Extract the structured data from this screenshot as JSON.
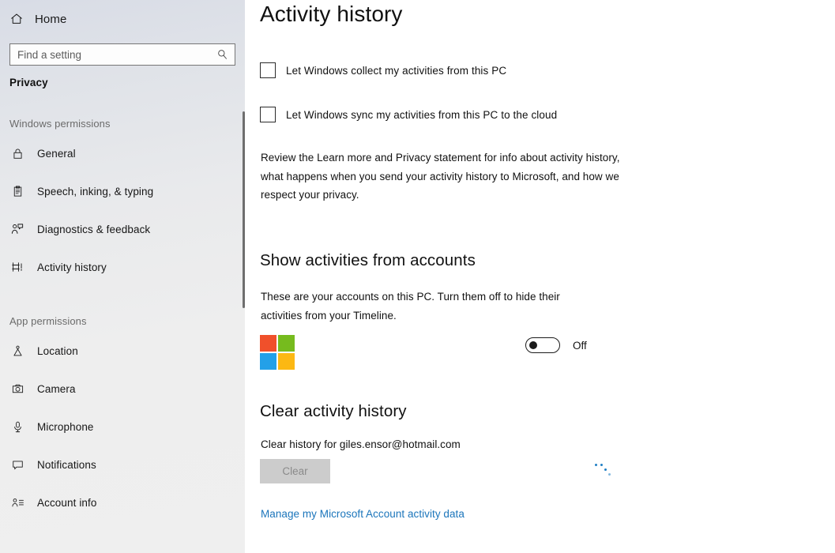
{
  "sidebar": {
    "home": {
      "label": "Home",
      "icon": "home-icon"
    },
    "search": {
      "placeholder": "Find a setting",
      "value": "",
      "icon": "search-icon"
    },
    "category": "Privacy",
    "groups": [
      {
        "heading": "Windows permissions",
        "items": [
          {
            "label": "General",
            "icon": "lock-icon"
          },
          {
            "label": "Speech, inking, & typing",
            "icon": "clipboard-icon"
          },
          {
            "label": "Diagnostics & feedback",
            "icon": "person-feedback-icon"
          },
          {
            "label": "Activity history",
            "icon": "activity-history-icon"
          }
        ]
      },
      {
        "heading": "App permissions",
        "items": [
          {
            "label": "Location",
            "icon": "location-pin-icon"
          },
          {
            "label": "Camera",
            "icon": "camera-icon"
          },
          {
            "label": "Microphone",
            "icon": "microphone-icon"
          },
          {
            "label": "Notifications",
            "icon": "notification-icon"
          },
          {
            "label": "Account info",
            "icon": "account-info-icon"
          }
        ]
      }
    ]
  },
  "main": {
    "title": "Activity history",
    "checkboxes": [
      {
        "label": "Let Windows collect my activities from this PC",
        "checked": false
      },
      {
        "label": "Let Windows sync my activities from this PC to the cloud",
        "checked": false
      }
    ],
    "description": "Review the Learn more and Privacy statement for info about activity history, what happens when you send your activity history to Microsoft, and how we respect your privacy.",
    "accounts_section": {
      "heading": "Show activities from accounts",
      "description": "These are your accounts on this PC. Turn them off to hide their activities from your Timeline.",
      "account_logo": "microsoft-logo-icon",
      "toggle_state": "Off",
      "toggle_on": false
    },
    "clear_section": {
      "heading": "Clear activity history",
      "account_line": "Clear history for giles.ensor@hotmail.com",
      "button_label": "Clear",
      "button_disabled": true,
      "spinner": "loading-dots-icon",
      "link_label": "Manage my Microsoft Account activity data"
    }
  },
  "colors": {
    "accent_link": "#1b75bb",
    "ms_red": "#f0502b",
    "ms_green": "#76bb1e",
    "ms_blue": "#23a0e8",
    "ms_yellow": "#fcb813",
    "spinner_blue": "#1f7fc4"
  }
}
